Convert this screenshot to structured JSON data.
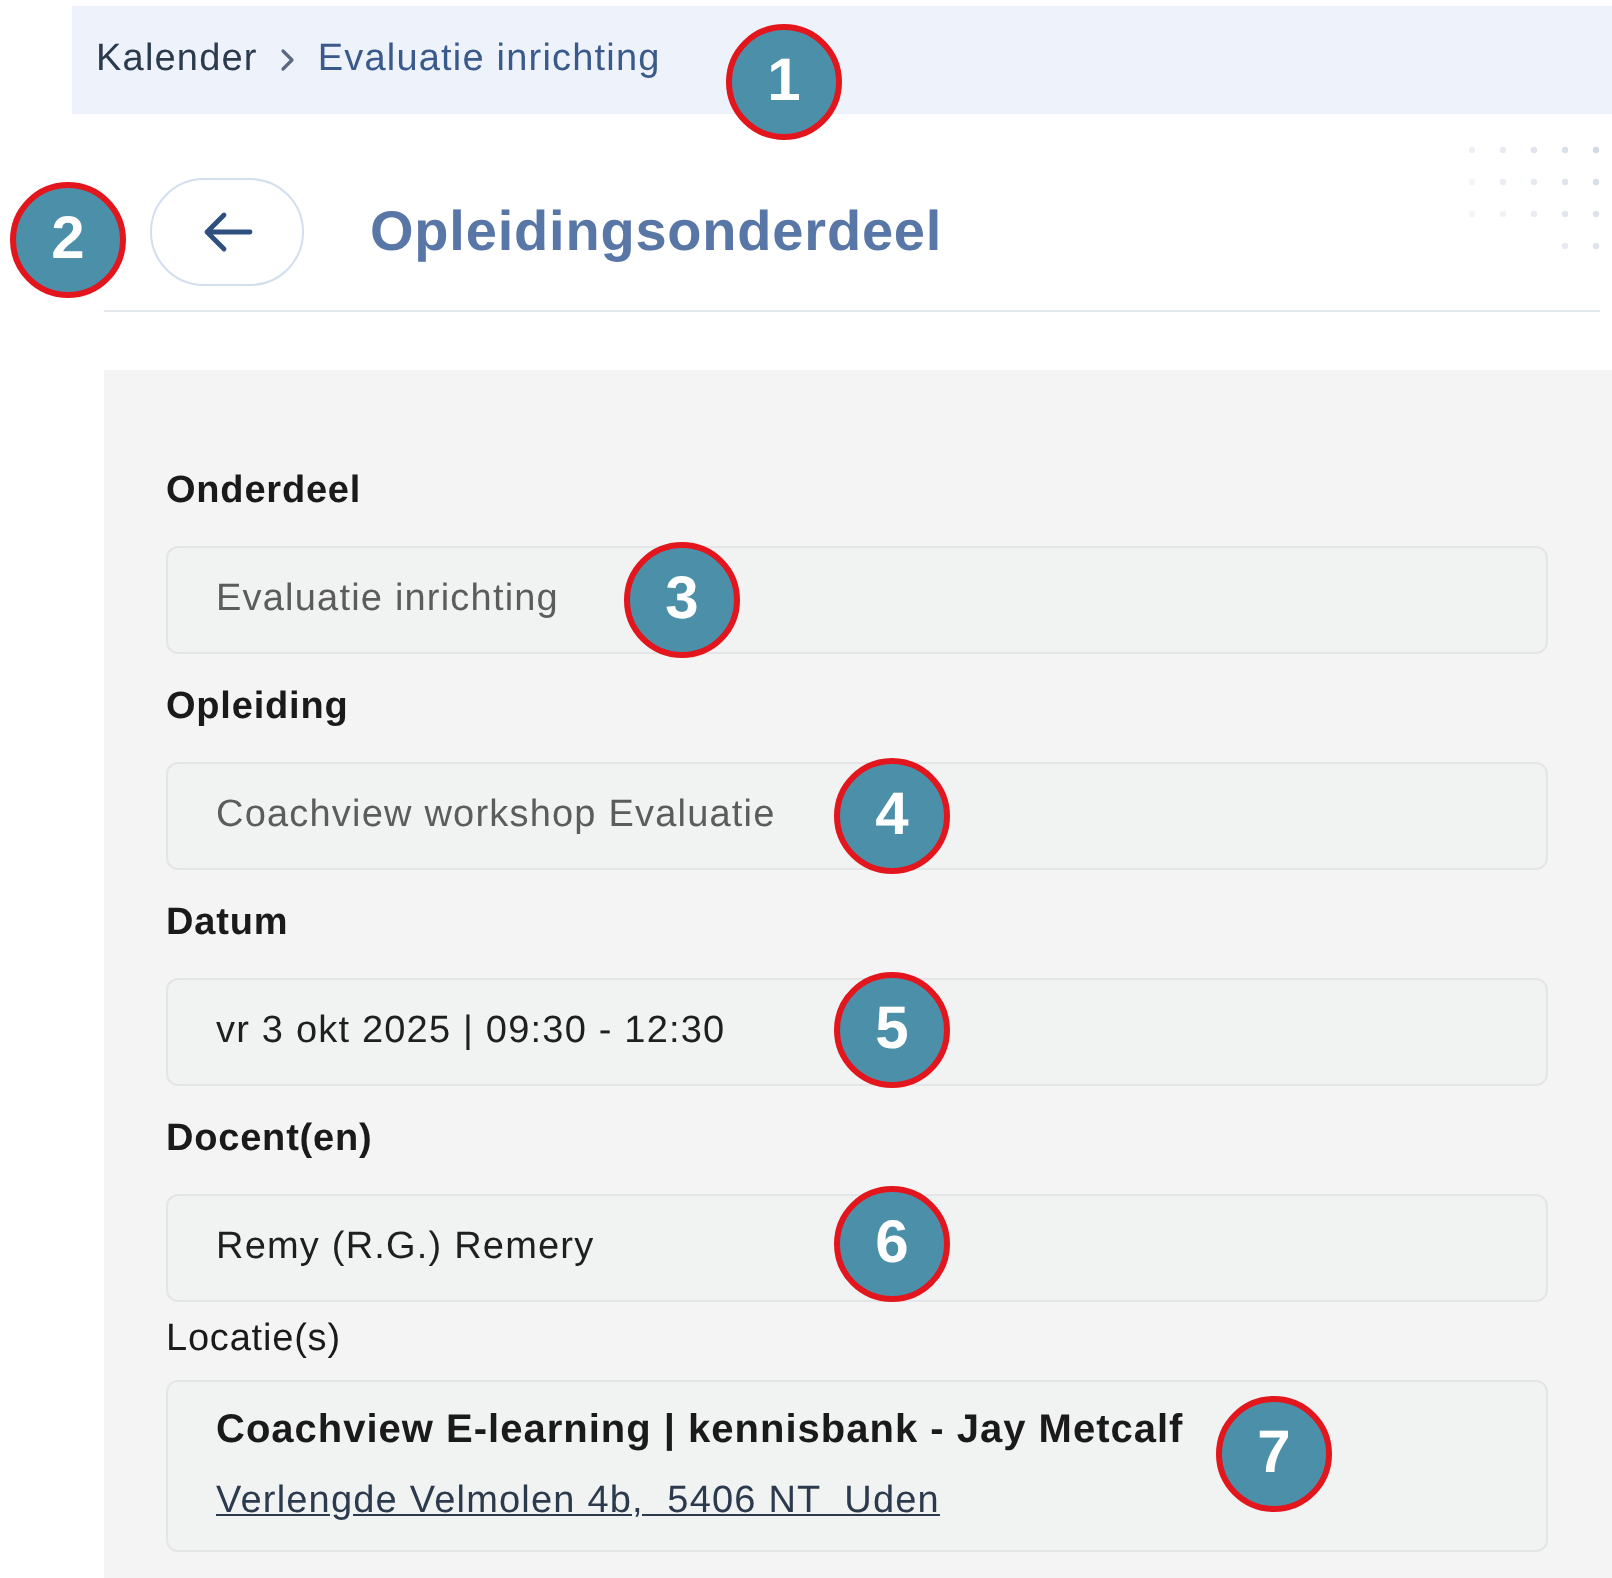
{
  "breadcrumb": [
    {
      "label": "Kalender",
      "current": false
    },
    {
      "label": "Evaluatie inrichting",
      "current": true
    }
  ],
  "header": {
    "title": "Opleidingsonderdeel"
  },
  "fields": [
    {
      "kind": "text",
      "label": "Onderdeel",
      "value": "Evaluatie inrichting",
      "disabled": true
    },
    {
      "kind": "text",
      "label": "Opleiding",
      "value": "Coachview workshop Evaluatie",
      "disabled": true
    },
    {
      "kind": "text",
      "label": "Datum",
      "value": "vr 3 okt 2025 | 09:30 - 12:30",
      "disabled": false
    },
    {
      "kind": "text",
      "label": "Docent(en)",
      "value": "Remy (R.G.) Remery",
      "disabled": false
    },
    {
      "kind": "location",
      "label": "Locatie(s)",
      "title": "Coachview E-learning | kennisbank - Jay Metcalf",
      "address": "Verlengde Velmolen 4b,  5406 NT  Uden"
    }
  ],
  "callouts": [
    {
      "label": "1"
    },
    {
      "label": "2"
    },
    {
      "label": "3"
    },
    {
      "label": "4"
    },
    {
      "label": "5"
    },
    {
      "label": "6"
    },
    {
      "label": "7"
    }
  ]
}
